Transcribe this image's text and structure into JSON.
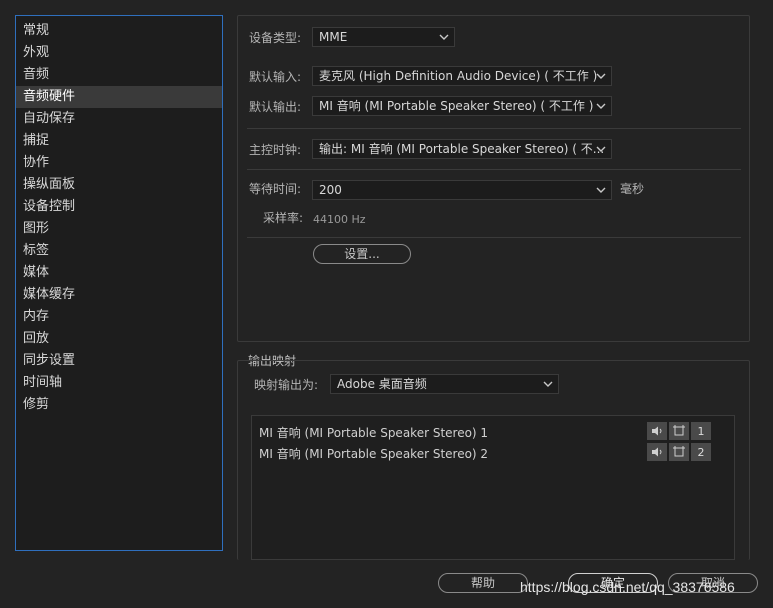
{
  "sidebar": {
    "items": [
      "常规",
      "外观",
      "音频",
      "音频硬件",
      "自动保存",
      "捕捉",
      "协作",
      "操纵面板",
      "设备控制",
      "图形",
      "标签",
      "媒体",
      "媒体缓存",
      "内存",
      "回放",
      "同步设置",
      "时间轴",
      "修剪"
    ],
    "selected_index": 3
  },
  "device": {
    "type_label": "设备类型:",
    "type_value": "MME",
    "default_input_label": "默认输入:",
    "default_input_value": "麦克风 (High Definition Audio Device) ( 不工作 )",
    "default_output_label": "默认输出:",
    "default_output_value": "MI 音响 (MI Portable Speaker Stereo) ( 不工作 )",
    "master_clock_label": "主控时钟:",
    "master_clock_value": "输出: MI 音响 (MI Portable Speaker Stereo) ( 不...",
    "latency_label": "等待时间:",
    "latency_value": "200",
    "latency_unit": "毫秒",
    "sample_rate_label": "采样率:",
    "sample_rate_value": "44100 Hz",
    "settings_button": "设置..."
  },
  "output_mapping": {
    "section_title": "输出映射",
    "map_to_label": "映射输出为:",
    "map_to_value": "Adobe 桌面音频",
    "channels": [
      {
        "name": "MI 音响 (MI Portable Speaker Stereo) 1",
        "number": "1",
        "icon": "speaker-icon"
      },
      {
        "name": "MI 音响 (MI Portable Speaker Stereo) 2",
        "number": "2",
        "icon": "speaker-icon"
      }
    ]
  },
  "footer": {
    "help_button": "帮助",
    "ok_button": "确定",
    "cancel_button": "取消"
  },
  "watermark": "https://blog.csdn.net/qq_38376586",
  "colors": {
    "selection_border": "#2f6fbd",
    "background": "#232323"
  }
}
